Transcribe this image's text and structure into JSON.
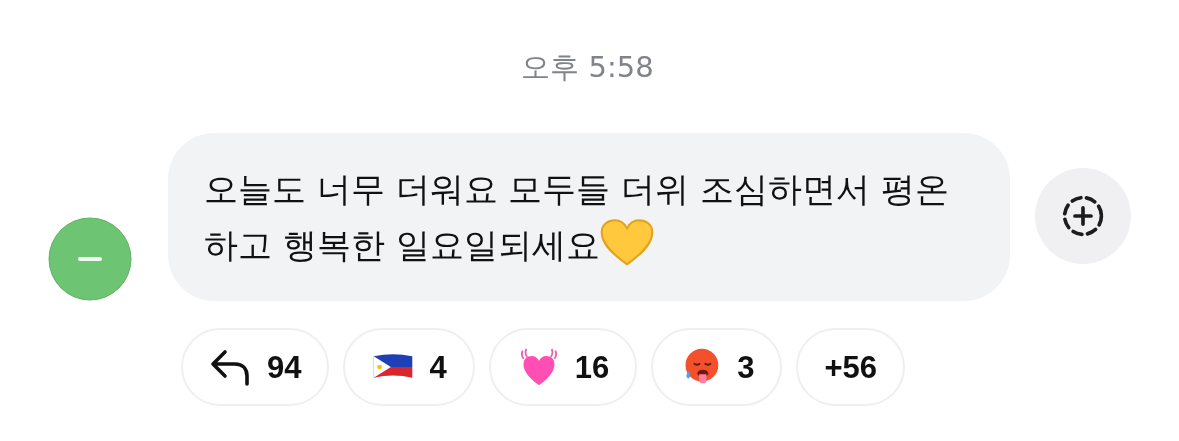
{
  "timestamp": "오후 5:58",
  "message": {
    "text": "오늘도 너무 더워요 모두들 더위 조심하면서 평온하고 행복한 일요일되세요"
  },
  "reactions": [
    {
      "kind": "reply",
      "count": "94"
    },
    {
      "kind": "flag",
      "count": "4"
    },
    {
      "kind": "heart",
      "count": "16"
    },
    {
      "kind": "hot-face",
      "count": "3"
    },
    {
      "kind": "more",
      "count": "+56"
    }
  ]
}
